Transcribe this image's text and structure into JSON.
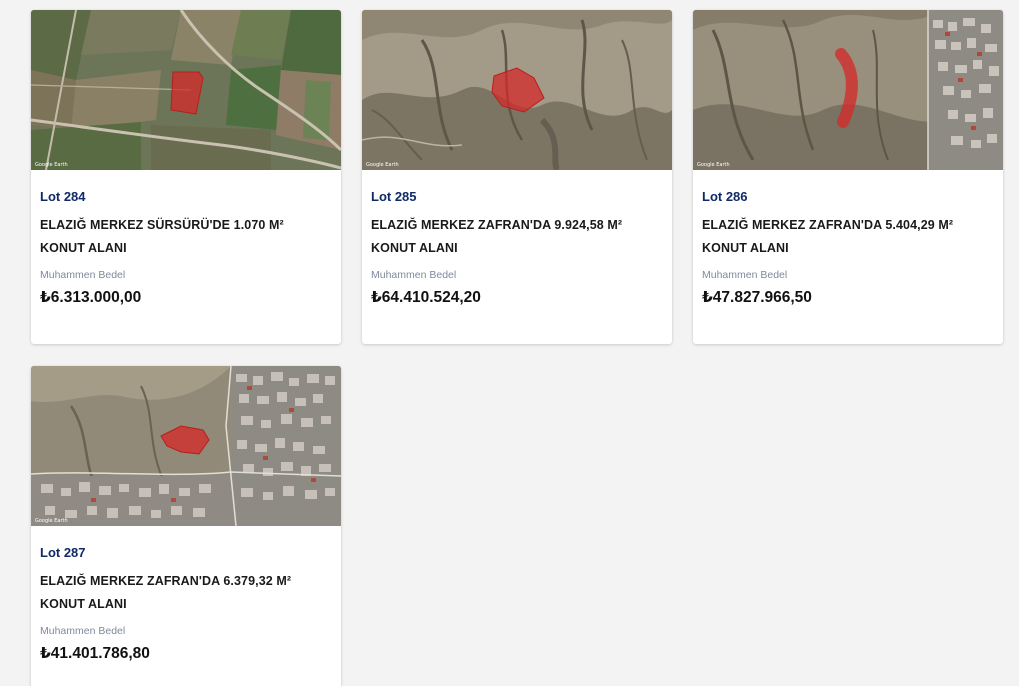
{
  "lots": [
    {
      "lot": "Lot 284",
      "title": "ELAZIĞ MERKEZ SÜRSÜRÜ'DE 1.070 M² KONUT ALANI",
      "price_label": "Muhammen Bedel",
      "price": "₺6.313.000,00",
      "map_style": "farmland"
    },
    {
      "lot": "Lot 285",
      "title": "ELAZIĞ MERKEZ ZAFRAN'DA 9.924,58 M² KONUT ALANI",
      "price_label": "Muhammen Bedel",
      "price": "₺64.410.524,20",
      "map_style": "hills"
    },
    {
      "lot": "Lot 286",
      "title": "ELAZIĞ MERKEZ ZAFRAN'DA 5.404,29 M² KONUT ALANI",
      "price_label": "Muhammen Bedel",
      "price": "₺47.827.966,50",
      "map_style": "hills-town"
    },
    {
      "lot": "Lot 287",
      "title": "ELAZIĞ MERKEZ ZAFRAN'DA 6.379,32 M² KONUT ALANI",
      "price_label": "Muhammen Bedel",
      "price": "₺41.401.786,80",
      "map_style": "town"
    }
  ],
  "colors": {
    "lot_label": "#0f2a66",
    "parcel_highlight": "#d42a2a",
    "background": "#f3f3f3"
  }
}
